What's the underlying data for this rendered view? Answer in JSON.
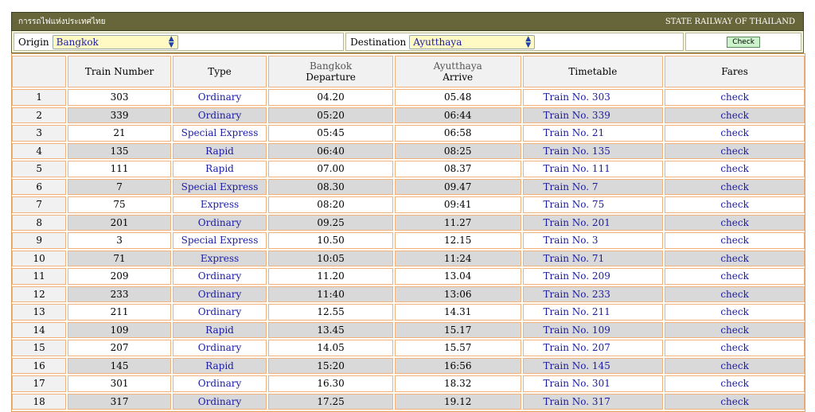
{
  "banner": {
    "left_title": "การรถไฟแห่งประเทศไทย",
    "right_title": "STATE RAILWAY OF THAILAND"
  },
  "controls": {
    "origin_label": "Origin",
    "origin_value": "Bangkok",
    "destination_label": "Destination",
    "destination_value": "Ayutthaya",
    "check_label": "Check"
  },
  "table": {
    "headers": {
      "train_number": "Train Number",
      "type": "Type",
      "departure_station": "Bangkok",
      "departure": "Departure",
      "arrive_station": "Ayutthaya",
      "arrive": "Arrive",
      "timetable": "Timetable",
      "fares": "Fares"
    },
    "rows": [
      {
        "n": "1",
        "train": "303",
        "type": "Ordinary",
        "dep": "04.20",
        "arr": "05.48",
        "tt": "Train No. 303",
        "fare": "check"
      },
      {
        "n": "2",
        "train": "339",
        "type": "Ordinary",
        "dep": "05:20",
        "arr": "06:44",
        "tt": "Train No. 339",
        "fare": "check"
      },
      {
        "n": "3",
        "train": "21",
        "type": "Special Express",
        "dep": "05:45",
        "arr": "06:58",
        "tt": "Train No. 21",
        "fare": "check"
      },
      {
        "n": "4",
        "train": "135",
        "type": "Rapid",
        "dep": "06:40",
        "arr": "08:25",
        "tt": "Train No. 135",
        "fare": "check"
      },
      {
        "n": "5",
        "train": "111",
        "type": "Rapid",
        "dep": "07.00",
        "arr": "08.37",
        "tt": "Train No. 111",
        "fare": "check"
      },
      {
        "n": "6",
        "train": "7",
        "type": "Special Express",
        "dep": "08.30",
        "arr": "09.47",
        "tt": "Train No. 7",
        "fare": "check"
      },
      {
        "n": "7",
        "train": "75",
        "type": "Express",
        "dep": "08:20",
        "arr": "09:41",
        "tt": "Train No. 75",
        "fare": "check"
      },
      {
        "n": "8",
        "train": "201",
        "type": "Ordinary",
        "dep": "09.25",
        "arr": "11.27",
        "tt": "Train No. 201",
        "fare": "check"
      },
      {
        "n": "9",
        "train": "3",
        "type": "Special Express",
        "dep": "10.50",
        "arr": "12.15",
        "tt": "Train No. 3",
        "fare": "check"
      },
      {
        "n": "10",
        "train": "71",
        "type": "Express",
        "dep": "10:05",
        "arr": "11:24",
        "tt": "Train No. 71",
        "fare": "check"
      },
      {
        "n": "11",
        "train": "209",
        "type": "Ordinary",
        "dep": "11.20",
        "arr": "13.04",
        "tt": "Train No. 209",
        "fare": "check"
      },
      {
        "n": "12",
        "train": "233",
        "type": "Ordinary",
        "dep": "11:40",
        "arr": "13:06",
        "tt": "Train No. 233",
        "fare": "check"
      },
      {
        "n": "13",
        "train": "211",
        "type": "Ordinary",
        "dep": "12.55",
        "arr": "14.31",
        "tt": "Train No. 211",
        "fare": "check"
      },
      {
        "n": "14",
        "train": "109",
        "type": "Rapid",
        "dep": "13.45",
        "arr": "15.17",
        "tt": "Train No. 109",
        "fare": "check"
      },
      {
        "n": "15",
        "train": "207",
        "type": "Ordinary",
        "dep": "14.05",
        "arr": "15.57",
        "tt": "Train No. 207",
        "fare": "check"
      },
      {
        "n": "16",
        "train": "145",
        "type": "Rapid",
        "dep": "15:20",
        "arr": "16:56",
        "tt": "Train No. 145",
        "fare": "check"
      },
      {
        "n": "17",
        "train": "301",
        "type": "Ordinary",
        "dep": "16.30",
        "arr": "18.32",
        "tt": "Train No. 301",
        "fare": "check"
      },
      {
        "n": "18",
        "train": "317",
        "type": "Ordinary",
        "dep": "17.25",
        "arr": "19.12",
        "tt": "Train No. 317",
        "fare": "check"
      }
    ]
  }
}
